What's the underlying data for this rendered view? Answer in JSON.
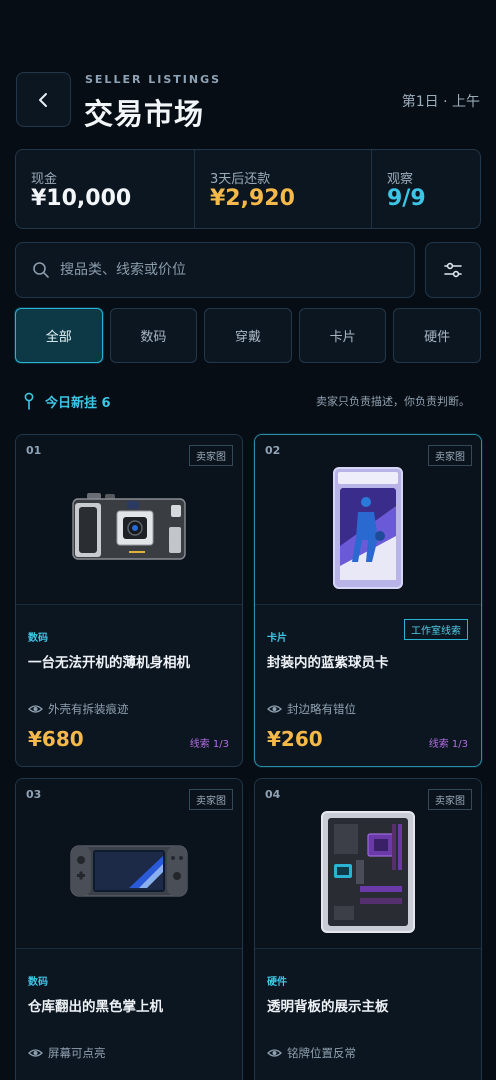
{
  "header": {
    "eyebrow": "SELLER LISTINGS",
    "title": "交易市场",
    "day": "第1日 · 上午"
  },
  "stats": [
    {
      "label": "现金",
      "value": "¥10,000",
      "color": "#f3f6f9"
    },
    {
      "label": "3天后还款",
      "value": "¥2,920",
      "color": "#f5b94a"
    },
    {
      "label": "观察",
      "value": "9/9",
      "color": "#3cc6e6"
    }
  ],
  "search": {
    "placeholder": "搜品类、线索或价位"
  },
  "tabs": [
    {
      "label": "全部",
      "active": true
    },
    {
      "label": "数码",
      "active": false
    },
    {
      "label": "穿戴",
      "active": false
    },
    {
      "label": "卡片",
      "active": false
    },
    {
      "label": "硬件",
      "active": false
    }
  ],
  "new_listings": {
    "label": "今日新挂 6",
    "disclaimer": "卖家只负责描述，你负责判断。"
  },
  "colors": {
    "accent": "#3cc6e6",
    "price": "#f5b94a",
    "clue": "#b36ee6"
  },
  "cards": [
    {
      "num": "01",
      "tag": "卖家图",
      "category": "数码",
      "name": "一台无法开机的薄机身相机",
      "flaw": "外壳有拆装痕迹",
      "price": "¥680",
      "clue": "线索 1/3",
      "icon": "camera-illustration"
    },
    {
      "num": "02",
      "tag": "卖家图",
      "category": "卡片",
      "name": "封装内的蓝紫球员卡",
      "flaw": "封边略有错位",
      "price": "¥260",
      "clue": "线索 1/3",
      "workshop_tag": "工作室线索",
      "icon": "graded-card-illustration"
    },
    {
      "num": "03",
      "tag": "卖家图",
      "category": "数码",
      "name": "仓库翻出的黑色掌上机",
      "flaw": "屏幕可点亮",
      "icon": "handheld-console-illustration"
    },
    {
      "num": "04",
      "tag": "卖家图",
      "category": "硬件",
      "name": "透明背板的展示主板",
      "flaw": "铭牌位置反常",
      "icon": "motherboard-illustration"
    }
  ]
}
